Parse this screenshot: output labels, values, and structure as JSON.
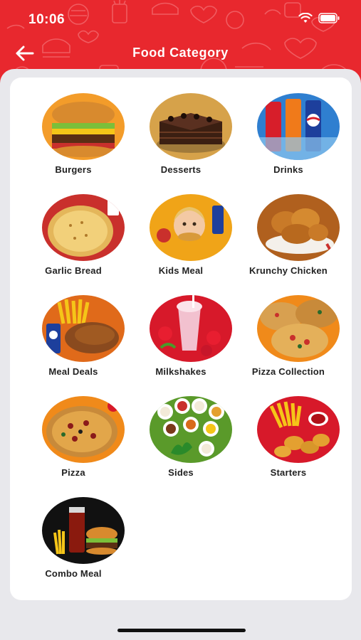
{
  "status_bar": {
    "time": "10:06"
  },
  "header": {
    "title": "Food Category"
  },
  "categories": [
    {
      "label": "Burgers"
    },
    {
      "label": "Desserts"
    },
    {
      "label": "Drinks"
    },
    {
      "label": "Garlic Bread"
    },
    {
      "label": "Kids Meal"
    },
    {
      "label": "Krunchy Chicken"
    },
    {
      "label": "Meal Deals"
    },
    {
      "label": "Milkshakes"
    },
    {
      "label": "Pizza Collection"
    },
    {
      "label": "Pizza"
    },
    {
      "label": "Sides"
    },
    {
      "label": "Starters"
    },
    {
      "label": "Combo Meal"
    }
  ],
  "colors": {
    "header": "#e8282e",
    "background": "#e8e8ec",
    "card": "#ffffff"
  },
  "icons": {
    "back": "arrow-left-icon",
    "wifi": "wifi-icon",
    "battery": "battery-icon"
  }
}
